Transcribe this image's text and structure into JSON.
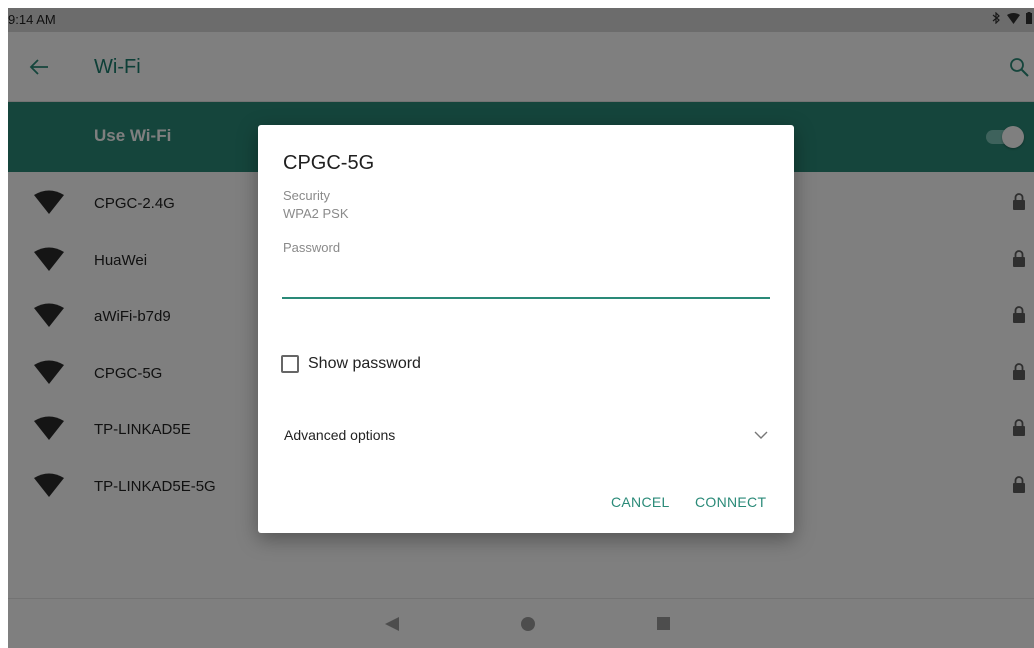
{
  "status_bar": {
    "time": "9:14 AM",
    "icons": [
      "bluetooth-icon",
      "wifi-signal-icon",
      "battery-icon"
    ]
  },
  "app_bar": {
    "title": "Wi-Fi",
    "back_icon": "arrow-back-icon",
    "search_icon": "search-icon"
  },
  "wifi_toggle": {
    "label": "Use Wi-Fi",
    "enabled": true
  },
  "networks": [
    {
      "name": "CPGC-2.4G",
      "secured": true
    },
    {
      "name": "HuaWei",
      "secured": true
    },
    {
      "name": "aWiFi-b7d9",
      "secured": true
    },
    {
      "name": "CPGC-5G",
      "secured": true
    },
    {
      "name": "TP-LINKAD5E",
      "secured": true
    },
    {
      "name": "TP-LINKAD5E-5G",
      "secured": true
    }
  ],
  "dialog": {
    "title": "CPGC-5G",
    "security_label": "Security",
    "security_value": "WPA2 PSK",
    "password_label": "Password",
    "password_value": "",
    "show_password_label": "Show password",
    "show_password_checked": false,
    "advanced_label": "Advanced options",
    "cancel_label": "CANCEL",
    "connect_label": "CONNECT"
  },
  "colors": {
    "accent": "#2a8a78",
    "accent_text": "#1a7f6e",
    "scrim": "rgba(0,0,0,0.5)"
  }
}
